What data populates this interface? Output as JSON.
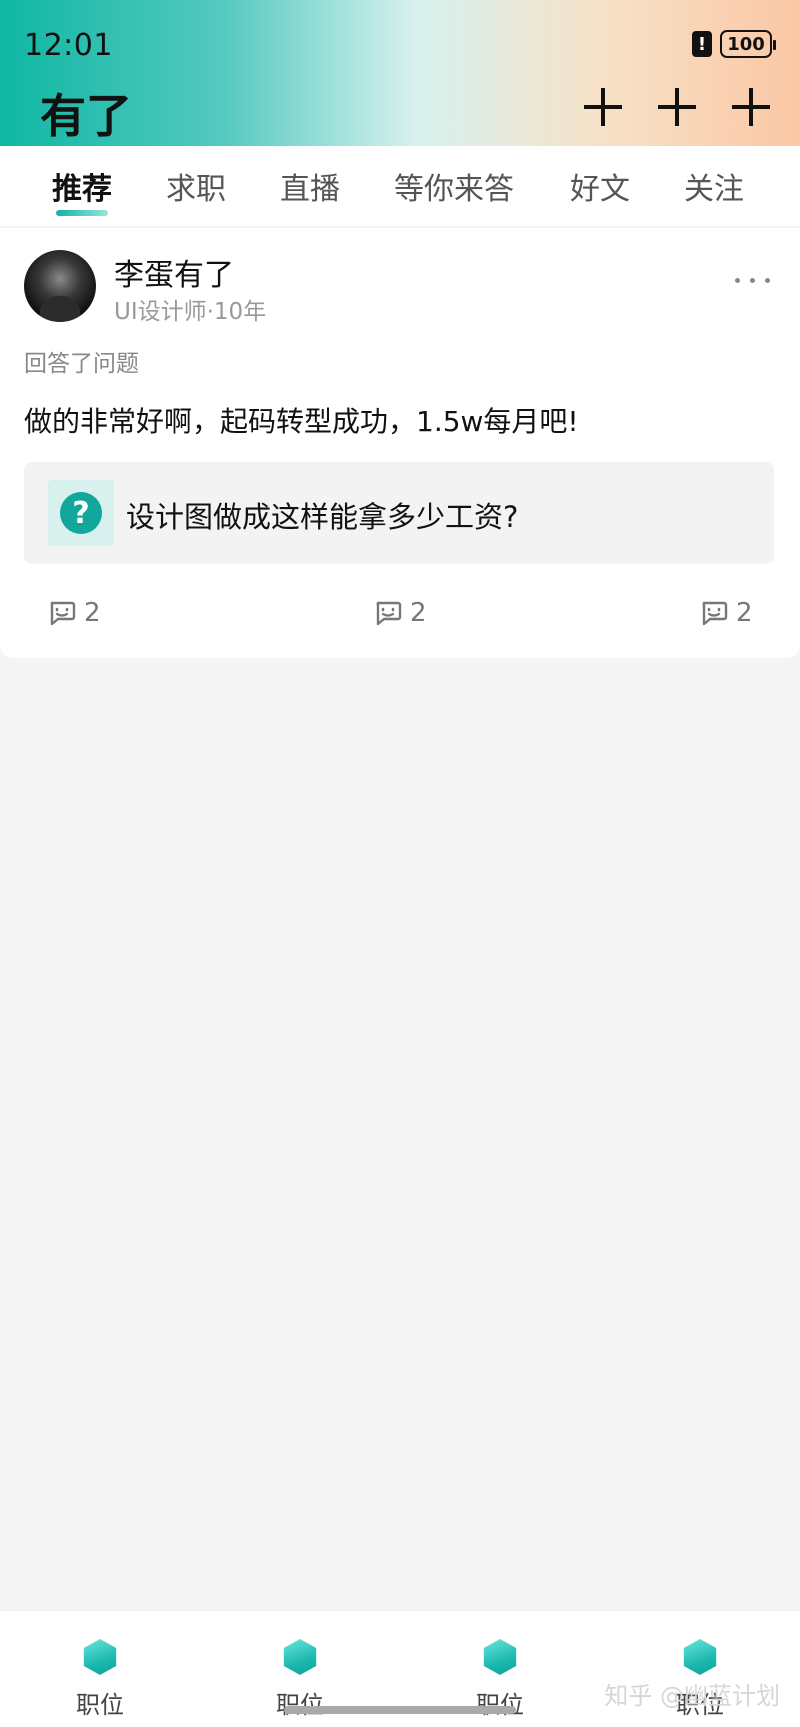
{
  "status_bar": {
    "time": "12:01",
    "battery": "100",
    "battery_alert": "!"
  },
  "header": {
    "title": "有了",
    "plus_count": 3
  },
  "tabs": [
    {
      "label": "推荐",
      "active": true
    },
    {
      "label": "求职",
      "active": false
    },
    {
      "label": "直播",
      "active": false
    },
    {
      "label": "等你来答",
      "active": false
    },
    {
      "label": "好文",
      "active": false
    },
    {
      "label": "关注",
      "active": false
    }
  ],
  "post": {
    "author": "李蛋有了",
    "meta": "UI设计师·10年",
    "action": "回答了问题",
    "answer": "做的非常好啊，起码转型成功，1.5w每月吧!",
    "question_icon": "?",
    "question": "设计图做成这样能拿多少工资?",
    "stats": [
      "2",
      "2",
      "2"
    ]
  },
  "bottom_nav": [
    {
      "label": "职位",
      "icon": "hexagon-icon"
    },
    {
      "label": "职位",
      "icon": "hexagon-icon"
    },
    {
      "label": "职位",
      "icon": "hexagon-icon"
    },
    {
      "label": "职位",
      "icon": "hexagon-icon"
    }
  ],
  "watermark": "知乎 @幽蓝计划",
  "colors": {
    "accent": "#13a79c",
    "gradient_left": "#0fb7a3",
    "gradient_right": "#fbc7a5"
  }
}
